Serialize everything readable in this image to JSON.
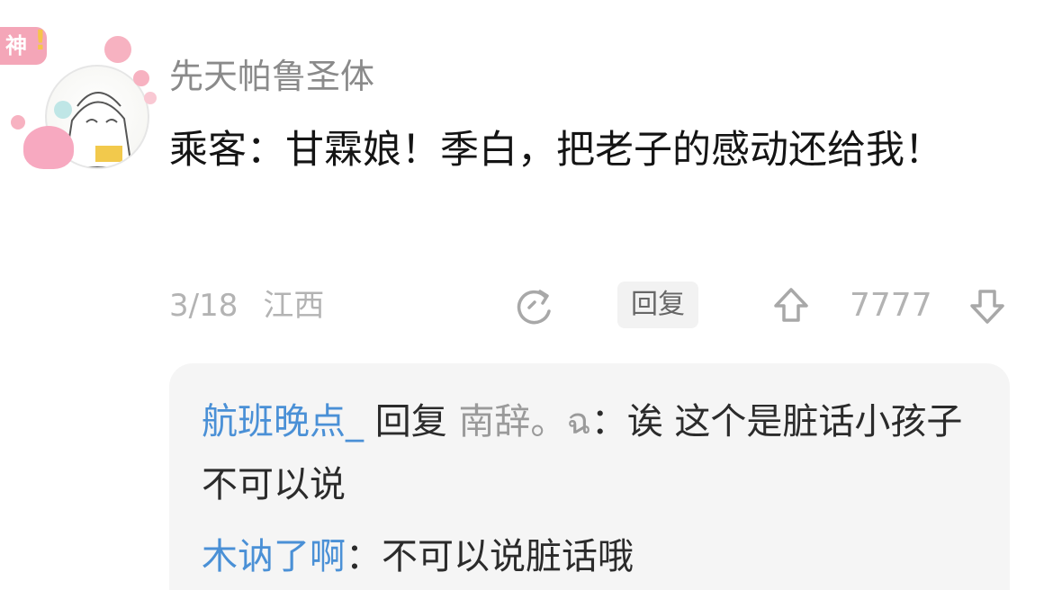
{
  "post": {
    "badge_text": "神",
    "badge_mark": "!",
    "username": "先天帕鲁圣体",
    "comment_text": "乘客：甘霖娘！季白，把老子的感动还给我！",
    "date": "3/18",
    "location": "江西",
    "reply_label": "回复",
    "vote_count": "7777"
  },
  "replies": [
    {
      "author": "航班晚点_",
      "reply_word": " 回复 ",
      "target": "南辞。ฉ",
      "sep": "：",
      "text": "诶 这个是脏话小孩子不可以说"
    },
    {
      "author": "木讷了啊",
      "sep": "：",
      "text": "不可以说脏话哦"
    }
  ],
  "colors": {
    "link_blue": "#4a90d6",
    "badge_pink": "#f4a6b8",
    "meta_gray": "#b3b3b3"
  },
  "icons": [
    "share-icon",
    "upvote-icon",
    "downvote-icon"
  ]
}
